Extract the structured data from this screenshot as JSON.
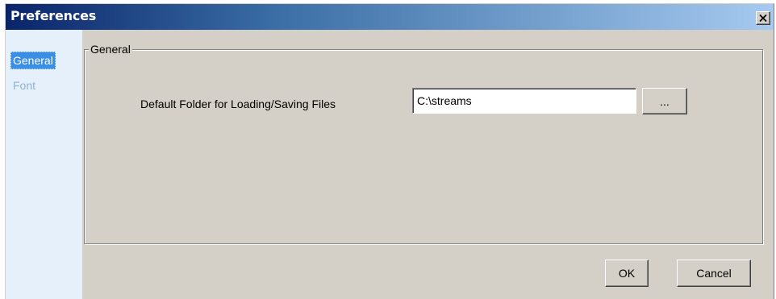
{
  "window": {
    "title": "Preferences",
    "close_glyph": "✕"
  },
  "sidebar": {
    "items": [
      {
        "label": "General",
        "selected": true
      },
      {
        "label": "Font",
        "selected": false
      }
    ]
  },
  "general_panel": {
    "legend": "General",
    "folder_label": "Default Folder for Loading/Saving Files",
    "folder_value": "C:\\streams",
    "browse_label": "..."
  },
  "footer": {
    "ok_label": "OK",
    "cancel_label": "Cancel"
  },
  "colors": {
    "titlebar_start": "#0a246a",
    "titlebar_end": "#a6caf0",
    "dialog_face": "#d4d0c8",
    "sidebar_bg": "#e6f0fa",
    "selection": "#3a8ee6",
    "sidebar_text": "#8fb2d8"
  }
}
